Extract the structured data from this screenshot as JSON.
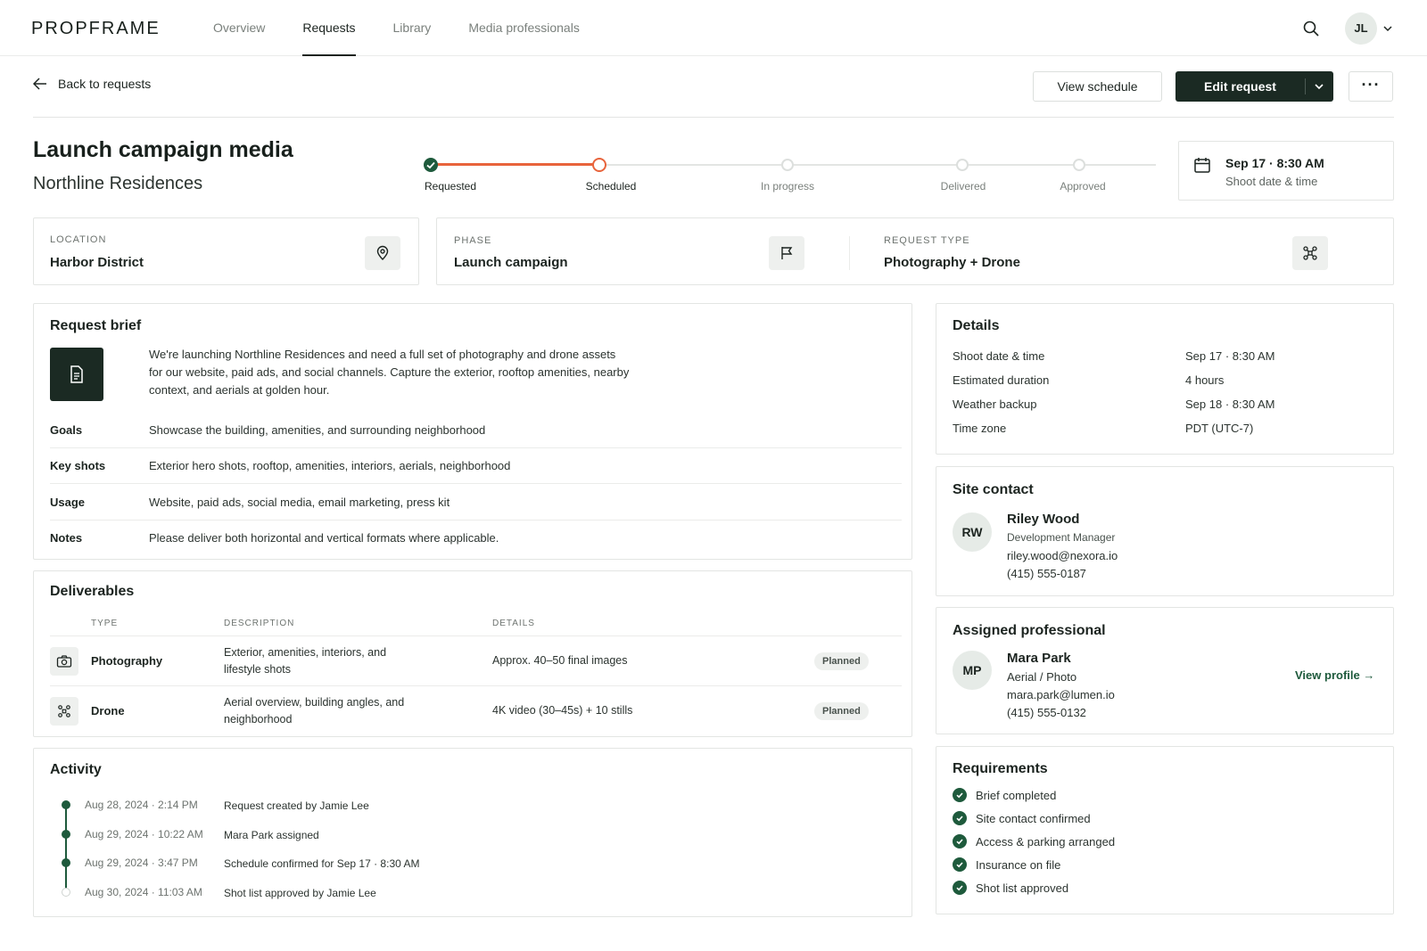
{
  "nav": {
    "logo": "PROPFRAME",
    "tabs": [
      "Overview",
      "Requests",
      "Library",
      "Media professionals"
    ],
    "active_tab": "Requests",
    "avatar": "JL"
  },
  "header": {
    "back_label": "Back to requests",
    "view_schedule": "View schedule",
    "edit_request": "Edit request",
    "more": "···",
    "title": "Launch campaign media",
    "subtitle": "Northline Residences"
  },
  "stepper": {
    "steps": [
      "Requested",
      "Scheduled",
      "In progress",
      "Delivered",
      "Approved"
    ],
    "completed": 1,
    "current": 2
  },
  "date_card": {
    "date": "Sep 17 · 8:30 AM",
    "label": "Shoot date & time"
  },
  "info": {
    "location_label": "LOCATION",
    "location_value": "Harbor District",
    "phase_label": "PHASE",
    "phase_value": "Launch campaign",
    "type_label": "REQUEST TYPE",
    "type_value": "Photography + Drone"
  },
  "brief": {
    "title": "Request brief",
    "text": "We're launching Northline Residences and need a full set of photography and drone assets for our website, paid ads, and social channels. Capture the exterior, rooftop amenities, nearby context, and aerials at golden hour.",
    "rows": [
      {
        "k": "Goals",
        "v": "Showcase the building, amenities, and surrounding neighborhood"
      },
      {
        "k": "Key shots",
        "v": "Exterior hero shots, rooftop, amenities, interiors, aerials, neighborhood"
      },
      {
        "k": "Usage",
        "v": "Website, paid ads, social media, email marketing, press kit"
      },
      {
        "k": "Notes",
        "v": "Please deliver both horizontal and vertical formats where applicable."
      }
    ]
  },
  "deliverables": {
    "title": "Deliverables",
    "headers": [
      "TYPE",
      "DESCRIPTION",
      "DETAILS"
    ],
    "rows": [
      {
        "type": "Photography",
        "desc": "Exterior, amenities, interiors, and lifestyle shots",
        "details": "Approx. 40–50 final images",
        "status": "Planned",
        "icon": "camera-icon"
      },
      {
        "type": "Drone",
        "desc": "Aerial overview, building angles, and neighborhood",
        "details": "4K video (30–45s) + 10 stills",
        "status": "Planned",
        "icon": "drone-icon"
      }
    ]
  },
  "activity": {
    "title": "Activity",
    "items": [
      {
        "time": "Aug 28, 2024 · 2:14 PM",
        "text": "Request created by Jamie Lee"
      },
      {
        "time": "Aug 29, 2024 · 10:22 AM",
        "text": "Mara Park assigned"
      },
      {
        "time": "Aug 29, 2024 · 3:47 PM",
        "text": "Schedule confirmed for Sep 17 · 8:30 AM"
      },
      {
        "time": "Aug 30, 2024 · 11:03 AM",
        "text": "Shot list approved by Jamie Lee"
      }
    ]
  },
  "details": {
    "title": "Details",
    "rows": [
      {
        "k": "Shoot date & time",
        "v": "Sep 17 · 8:30 AM"
      },
      {
        "k": "Estimated duration",
        "v": "4 hours"
      },
      {
        "k": "Weather backup",
        "v": "Sep 18 · 8:30 AM"
      },
      {
        "k": "Time zone",
        "v": "PDT (UTC-7)"
      }
    ]
  },
  "site_contact": {
    "title": "Site contact",
    "initials": "RW",
    "name": "Riley Wood",
    "role": "Development Manager",
    "email": "riley.wood@nexora.io",
    "phone": "(415) 555-0187"
  },
  "assigned": {
    "title": "Assigned professional",
    "initials": "MP",
    "name": "Mara Park",
    "role": "Aerial / Photo",
    "email": "mara.park@lumen.io",
    "phone": "(415) 555-0132",
    "link": "View profile →"
  },
  "requirements": {
    "title": "Requirements",
    "items": [
      "Brief completed",
      "Site contact confirmed",
      "Access & parking arranged",
      "Insurance on file",
      "Shot list approved"
    ]
  },
  "colors": {
    "accent": "#e8643c",
    "brand_dark": "#1b2a23",
    "success": "#1e5a3c"
  }
}
